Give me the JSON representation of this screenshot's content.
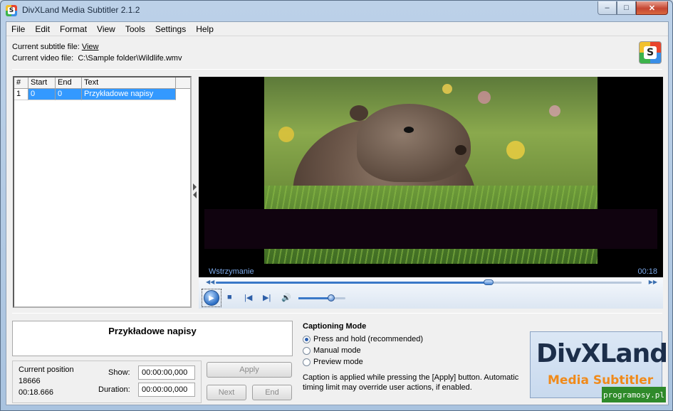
{
  "window": {
    "title": "DivXLand Media Subtitler 2.1.2",
    "minimize": "–",
    "maximize": "□",
    "close": "✕"
  },
  "menu": [
    "File",
    "Edit",
    "Format",
    "View",
    "Tools",
    "Settings",
    "Help"
  ],
  "info": {
    "subtitle_label": "Current subtitle file:",
    "subtitle_value": "View",
    "video_label": "Current video file:",
    "video_value": "C:\\Sample folder\\Wildlife.wmv"
  },
  "grid": {
    "headers": [
      "#",
      "Start",
      "End",
      "Text"
    ],
    "rows": [
      {
        "num": "1",
        "start": "0",
        "end": "0",
        "text": "Przykładowe napisy"
      }
    ]
  },
  "player": {
    "status": "Wstrzymanie",
    "time": "00:18",
    "seek_progress": 0.64,
    "volume": 0.7
  },
  "preview": {
    "text": "Przykładowe napisy"
  },
  "position": {
    "label": "Current position",
    "value_ms": "18666",
    "value_time": "00:18.666",
    "show_label": "Show:",
    "show_value": "00:00:00,000",
    "duration_label": "Duration:",
    "duration_value": "00:00:00,000"
  },
  "buttons": {
    "apply": "Apply",
    "next": "Next",
    "end": "End"
  },
  "captioning": {
    "title": "Captioning Mode",
    "options": [
      "Press and hold (recommended)",
      "Manual mode",
      "Preview mode"
    ],
    "selected": 0,
    "note": "Caption is applied while pressing the [Apply] button. Automatic timing limit may override user actions, if enabled."
  },
  "brand": {
    "top": "DivXLand",
    "sub": "Media Subtitler"
  },
  "watermark": "programosy.pl",
  "colors": {
    "selection": "#3399ff",
    "status_text": "#7aa7e8",
    "brand_orange": "#f08a1a"
  }
}
